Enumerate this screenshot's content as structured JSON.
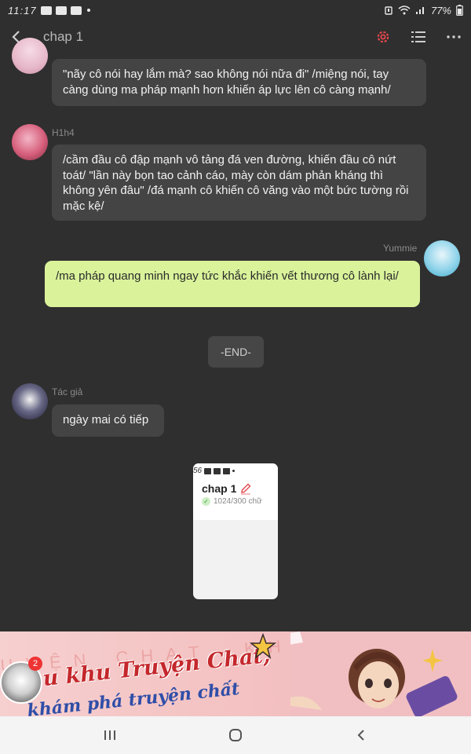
{
  "status_bar": {
    "time": "11:17",
    "app_icons": [
      "zalo-icon",
      "youtube-icon",
      "zalo-icon"
    ],
    "battery": "77%"
  },
  "app_bar": {
    "title": "chap 1",
    "icons": [
      "back-arrow-icon",
      "settings-gear-icon",
      "list-icon",
      "more-dots-icon"
    ],
    "accent_color": "#e5484d"
  },
  "messages": [
    {
      "side": "left",
      "sender": "",
      "text": "\"nãy cô nói hay lắm mà? sao không nói nữa đi\" /miệng nói, tay càng dùng ma pháp mạnh hơn khiến áp lực lên cô càng mạnh/"
    },
    {
      "side": "left",
      "sender": "H1h4",
      "text": "/cầm đầu cô đập mạnh vô tảng đá ven đường, khiến đầu cô nứt toát/ \"lần này bọn tao cảnh cáo, mày còn dám phản kháng thì không yên đâu\" /đá mạnh cô khiến cô văng vào một bức tường rồi mặc kệ/"
    },
    {
      "side": "right",
      "sender": "Yummie",
      "text": "/ma pháp quang minh ngay tức khắc khiến vết thương cô lành lại/"
    },
    {
      "side": "left",
      "sender": "Tác giả",
      "text": "ngày mai có tiếp"
    }
  ],
  "end_marker": "-END-",
  "attachment": {
    "status_time": "56",
    "title": "chap 1",
    "count": "1024/300 chữ"
  },
  "banner": {
    "bg_text": "UYỆN CHAT, KHÁM PHÁ",
    "headline": "u khu Truyện Chat,",
    "subline": "khám phá truyện chất",
    "badge": "2"
  },
  "colors": {
    "background": "#2f2f2f",
    "bubble_other": "#444444",
    "bubble_me": "#daf39b"
  }
}
